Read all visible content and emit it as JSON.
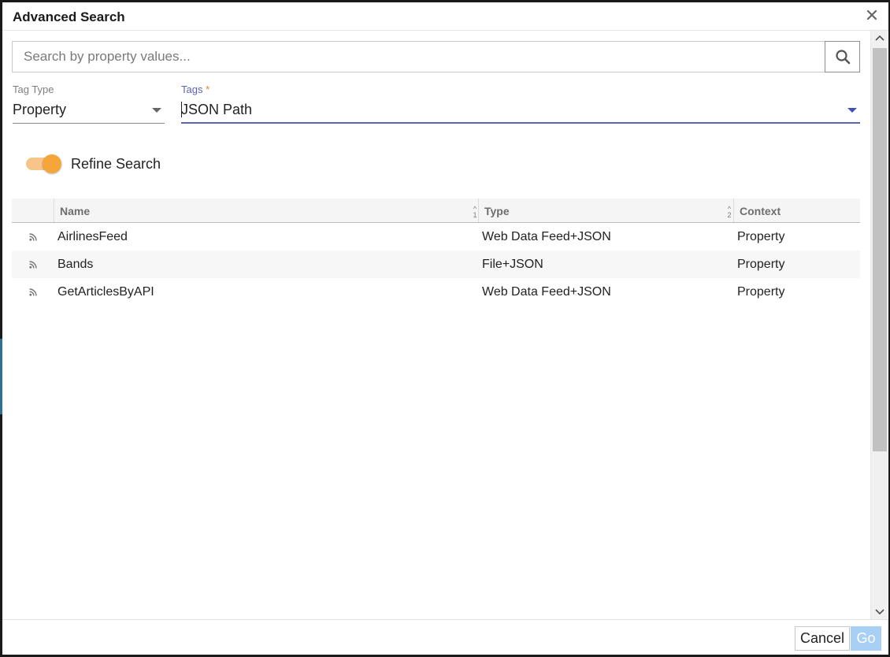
{
  "dialog": {
    "title": "Advanced Search"
  },
  "search": {
    "value": "",
    "placeholder": "Search by property values..."
  },
  "filters": {
    "tag_type_label": "Tag Type",
    "tag_type_value": "Property",
    "tags_label": "Tags",
    "tags_required_mark": "*",
    "tags_value": "JSON Path"
  },
  "refine": {
    "label": "Refine Search",
    "enabled": true
  },
  "table": {
    "columns": [
      {
        "label": "Name",
        "sort_order": "1"
      },
      {
        "label": "Type",
        "sort_order": "2"
      },
      {
        "label": "Context"
      }
    ],
    "rows": [
      {
        "icon": "rss-icon",
        "name": "AirlinesFeed",
        "type": "Web Data Feed+JSON",
        "context": "Property"
      },
      {
        "icon": "rss-icon",
        "name": "Bands",
        "type": "File+JSON",
        "context": "Property"
      },
      {
        "icon": "rss-icon",
        "name": "GetArticlesByAPI",
        "type": "Web Data Feed+JSON",
        "context": "Property"
      }
    ]
  },
  "footer": {
    "cancel_label": "Cancel",
    "go_label": "Go"
  },
  "colors": {
    "accent": "#f6a53b",
    "focus": "#5b63b8",
    "go_disabled": "#a8d0f5"
  }
}
